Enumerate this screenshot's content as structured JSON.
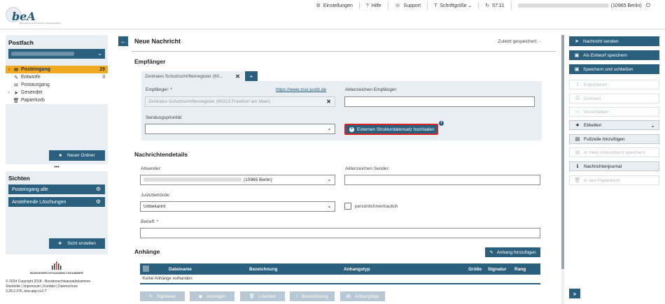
{
  "header": {
    "logo_text": "beA",
    "logo_sub": "Besonderes elektronisches Anwaltspostfach",
    "nav": [
      {
        "icon": "⚙",
        "label": "Einstellungen"
      },
      {
        "icon": "?",
        "label": "Hilfe"
      },
      {
        "icon": "☏",
        "label": "Support"
      },
      {
        "icon": "T",
        "label": "Schriftgröße ⌄"
      },
      {
        "icon": "↻",
        "label": "57:21"
      }
    ],
    "user_suffix": "(10965 Berlin)",
    "logout_icon": "⏻"
  },
  "sidebar": {
    "postfach_title": "Postfach",
    "folders": [
      {
        "arrow": "›",
        "icon": "✉",
        "label": "Posteingang",
        "count": "29"
      },
      {
        "arrow": "",
        "icon": "✎",
        "label": "Entwürfe",
        "count": "3"
      },
      {
        "arrow": "",
        "icon": "✉",
        "label": "Postausgang",
        "count": ""
      },
      {
        "arrow": "›",
        "icon": "➤",
        "label": "Gesendet",
        "count": ""
      },
      {
        "arrow": "",
        "icon": "🗑",
        "label": "Papierkorb",
        "count": ""
      }
    ],
    "new_folder_label": "Neuer Ordner",
    "dots": "•••",
    "sichten_title": "Sichten",
    "sichten": [
      {
        "label": "Posteingang alle"
      },
      {
        "label": "Anstehende Löschungen"
      }
    ],
    "create_view_label": "Sicht erstellen",
    "brak_label": "BUNDESRECHTSANWALTSKAMMER",
    "footer_lines": [
      "© 2024 Copyright 2018 - Bundesrechtsanwaltskammer",
      "Startseite | Impressum | Kontakt | Datenschutz",
      "3.28.2.376, bea-app-cc2-7"
    ]
  },
  "main": {
    "title": "Neue Nachricht",
    "saved": "Zuletzt gespeichert: -",
    "empfaenger": {
      "section": "Empfänger",
      "tab_label": "Zentrales Schutzschriftenregister (60...",
      "tab_add": "+",
      "recipient_label": "Empfänger: *",
      "recipient_link": "https://www.zssr.justiz.de",
      "recipient_value": "Zentrales Schutzschriftenregister (60313 Frankfurt am Main)",
      "aktenzeichen_label": "Aktenzeichen Empfänger:",
      "aktenzeichen_value": "",
      "prio_label": "Sendungspriorität:",
      "prio_value": "",
      "ext_button": "Externen Strukturdatensatz hochladen"
    },
    "details": {
      "section": "Nachrichtendetails",
      "absender_label": "Absender:",
      "absender_suffix": "(10965 Berlin)",
      "az_sender_label": "Aktenzeichen Sender:",
      "justiz_label": "Justizbehörde:",
      "justiz_value": "Unbekannt",
      "personal_label": "persönlich/vertraulich",
      "betreff_label": "Betreff: *",
      "betreff_value": ""
    },
    "anhaenge": {
      "section": "Anhänge",
      "add_button": "Anhang hinzufügen",
      "columns": [
        "Dateiname",
        "Bezeichnung",
        "Anhangstyp",
        "Größe",
        "Signatur",
        "Rang"
      ],
      "empty": "Keine Anhänge vorhanden",
      "actions": [
        {
          "icon": "✎",
          "label": "Signieren"
        },
        {
          "icon": "◉",
          "label": "Anzeigen"
        },
        {
          "icon": "🗑",
          "label": "Löschen"
        },
        {
          "icon": "I",
          "label": "Bezeichnung"
        },
        {
          "icon": "▤",
          "label": "Anhangstyp"
        }
      ]
    }
  },
  "right": {
    "buttons": [
      {
        "icon": "➤",
        "label": "Nachricht senden",
        "state": "dark"
      },
      {
        "icon": "▣",
        "label": "Als Entwurf speichern",
        "state": "dark"
      },
      {
        "icon": "▣",
        "label": "Speichern und schließen",
        "state": "dark"
      },
      {
        "icon": "⇪",
        "label": "Exportieren",
        "state": "dis"
      },
      {
        "icon": "⎙",
        "label": "Drucken",
        "state": "dis"
      },
      {
        "icon": "▭",
        "label": "Verschieben",
        "state": "dis"
      },
      {
        "icon": "★",
        "label": "Etiketten",
        "state": "ena",
        "chev": "⌄"
      },
      {
        "icon": "▤",
        "label": "Fußzeile hinzufügen",
        "state": "ena"
      },
      {
        "icon": "▤",
        "label": "In mein Adressbuch speichern",
        "state": "dis"
      },
      {
        "icon": "ℹ",
        "label": "Nachrichtenjournal",
        "state": "ena"
      },
      {
        "icon": "🗑",
        "label": "In den Papierkorb",
        "state": "dis"
      }
    ],
    "expand": "»"
  }
}
